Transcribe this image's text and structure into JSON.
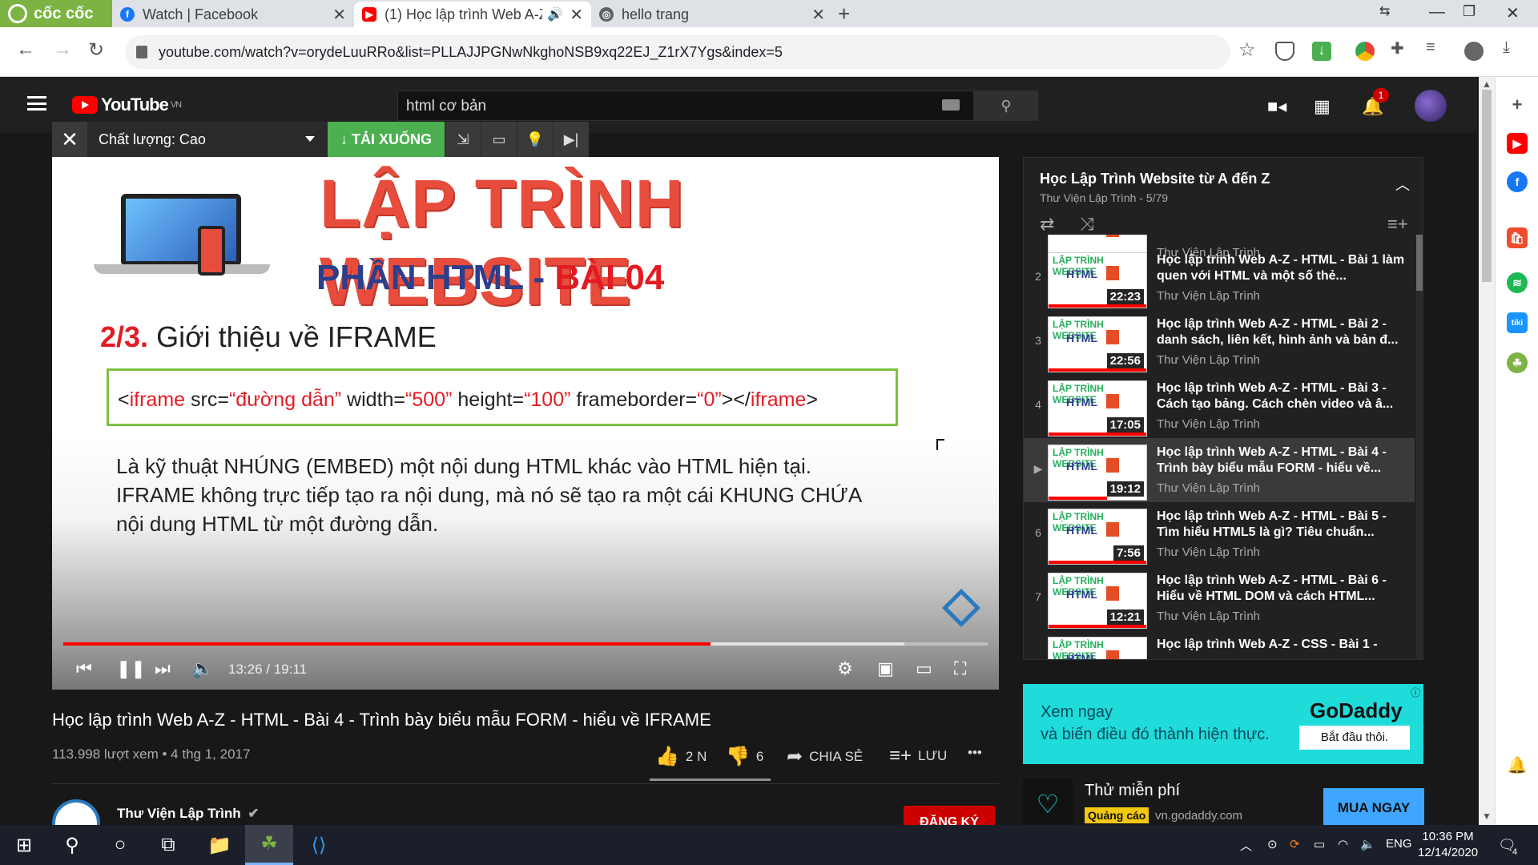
{
  "browser": {
    "brand": "cốc cốc",
    "tabs": [
      {
        "title": "Watch | Facebook",
        "icon": "facebook-icon",
        "color": "#1877f2"
      },
      {
        "title": "(1) Học lập trình Web A-Z",
        "icon": "youtube-icon",
        "color": "#ff0000"
      },
      {
        "title": "hello trang",
        "icon": "globe-icon",
        "color": "#5f6368"
      }
    ],
    "url": "youtube.com/watch?v=orydeLuuRRo&list=PLLAJJPGNwNkghoNSB9xq22EJ_Z1rX7Ygs&index=5"
  },
  "youtube": {
    "logo_text": "YouTube",
    "logo_region": "VN",
    "search_value": "html cơ bản",
    "notification_count": "1"
  },
  "downloader": {
    "quality_label": "Chất lượng: Cao",
    "download_label": "↓ TẢI XUỐNG"
  },
  "video_frame": {
    "title": "LẬP TRÌNH WEBSITE",
    "part_prefix": "PHẦN HTML -",
    "part_suffix": "BÀI 04",
    "heading_num": "2/3.",
    "heading_text": "Giới thiệu về IFRAME",
    "code": {
      "p1": "<",
      "tag": "iframe",
      "p2": " src=",
      "src": "“đường dẫn”",
      "p3": " width=",
      "width": "“500”",
      "p4": " height=",
      "height": "“100”",
      "p5": " frameborder=",
      "fb": "“0”",
      "p6": "></",
      "tag2": "iframe",
      "p7": ">"
    },
    "body_lines": [
      "Là kỹ thuật NHÚNG (EMBED) một nội dung HTML khác vào HTML hiện tại.",
      "IFRAME không trực tiếp tạo ra nội dung, mà nó sẽ tạo ra một cái KHUNG CHỨA",
      "nội dung HTML từ một đường dẫn."
    ]
  },
  "player": {
    "time": "13:26 / 19:11",
    "progress_fraction": 0.7,
    "buffered_fraction": 0.91
  },
  "video_info": {
    "title": "Học lập trình Web A-Z - HTML - Bài 4 - Trình bày biểu mẫu FORM - hiểu về IFRAME",
    "meta": "113.998 lượt xem • 4 thg 1, 2017",
    "likes": "2 N",
    "dislikes": "6",
    "share_label": "CHIA SẺ",
    "save_label": "LƯU",
    "channel_name": "Thư Viện Lập Trình",
    "subscribe_label": "ĐĂNG KÝ"
  },
  "playlist": {
    "title": "Học Lập Trình Website từ A đến Z",
    "subtitle": "Thư Viện Lập Trình - 5/79",
    "items": [
      {
        "index": "",
        "title": "",
        "channel": "Thư Viện Lập Trình",
        "duration": "",
        "current": false
      },
      {
        "index": "2",
        "title": "Học lập trình Web A-Z - HTML - Bài 1 làm quen với HTML và một số thẻ...",
        "channel": "Thư Viện Lập Trình",
        "duration": "22:23",
        "current": false
      },
      {
        "index": "3",
        "title": "Học lập trình Web A-Z - HTML - Bài 2 - danh sách, liên kết, hình ảnh và bản đ...",
        "channel": "Thư Viện Lập Trình",
        "duration": "22:56",
        "current": false
      },
      {
        "index": "4",
        "title": "Học lập trình Web A-Z - HTML - Bài 3 - Cách tạo bảng. Cách chèn video và â...",
        "channel": "Thư Viện Lập Trình",
        "duration": "17:05",
        "current": false
      },
      {
        "index": "▶",
        "title": "Học lập trình Web A-Z - HTML - Bài 4 - Trình bày biểu mẫu FORM - hiểu về...",
        "channel": "Thư Viện Lập Trình",
        "duration": "19:12",
        "current": true
      },
      {
        "index": "6",
        "title": "Học lập trình Web A-Z - HTML - Bài 5 - Tìm hiểu HTML5 là gì? Tiêu chuẩn...",
        "channel": "Thư Viện Lập Trình",
        "duration": "7:56",
        "current": false
      },
      {
        "index": "7",
        "title": "Học lập trình Web A-Z - HTML - Bài 6 - Hiểu về HTML DOM và cách HTML...",
        "channel": "Thư Viện Lập Trình",
        "duration": "12:21",
        "current": false
      },
      {
        "index": "",
        "title": "Học lập trình Web A-Z - CSS - Bài 1 -",
        "channel": "",
        "duration": "",
        "current": false
      }
    ],
    "thumb_label": "LẬP TRÌNH WEBSITE",
    "thumb_sub": "HTML"
  },
  "ad": {
    "line1": "Xem ngay",
    "line2": "và biến điều đó thành hiện thực.",
    "brand": "GoDaddy",
    "cta": "Bắt đầu thôi.",
    "card_title": "Thử miễn phí",
    "badge": "Quảng cáo",
    "url": "vn.godaddy.com",
    "button": "MUA NGAY"
  },
  "taskbar": {
    "lang": "ENG",
    "time": "10:36 PM",
    "date": "12/14/2020",
    "notif_count": "4"
  },
  "colors": {
    "accent_red": "#ff0000",
    "download_green": "#4caf50",
    "ad_teal": "#1fdbda",
    "brand_green": "#7cb342"
  }
}
